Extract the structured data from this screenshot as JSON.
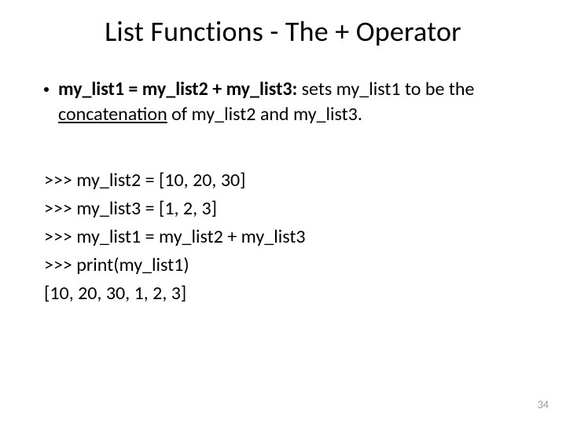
{
  "title": "List Functions - The + Operator",
  "bullet": {
    "bold_part": "my_list1 = my_list2 + my_list3:",
    "pre_underline": " sets my_list1 to be the ",
    "underline_word": "concatenation",
    "post_underline": " of my_list2 and my_list3."
  },
  "code_lines": [
    ">>> my_list2 = [10, 20, 30]",
    ">>> my_list3 = [1, 2, 3]",
    ">>> my_list1 = my_list2 + my_list3",
    ">>> print(my_list1)",
    "[10, 20, 30, 1, 2, 3]"
  ],
  "page_number": "34"
}
